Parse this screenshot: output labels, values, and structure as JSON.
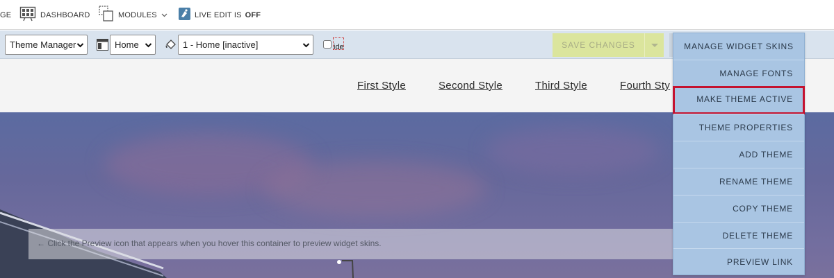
{
  "topbar": {
    "partial_label": "GE",
    "dashboard_label": "DASHBOARD",
    "modules_label": "MODULES",
    "live_edit_label": "LIVE EDIT IS",
    "live_edit_state": "OFF"
  },
  "toolbar": {
    "manager_select": "Theme Manager",
    "page_select": "Home",
    "theme_select": "1 - Home [inactive]",
    "ide_label": "ide",
    "save_label": "SAVE CHANGES"
  },
  "nav": {
    "links": [
      "First Style",
      "Second Style",
      "Third Style",
      "Fourth Sty"
    ]
  },
  "hero": {
    "hint": "← Click the Preview icon that appears when you hover this container to preview widget skins."
  },
  "menu": {
    "items": [
      "MANAGE WIDGET SKINS",
      "MANAGE FONTS",
      "MAKE THEME ACTIVE",
      "THEME PROPERTIES",
      "ADD THEME",
      "RENAME THEME",
      "COPY THEME",
      "DELETE THEME",
      "PREVIEW LINK"
    ],
    "highlighted_index": 2
  },
  "colors": {
    "menu_bg": "#a9c5e3",
    "highlight_border": "#c4122f",
    "toolbar_bg": "#d9e3ee",
    "save_bg": "#dbe59d"
  }
}
